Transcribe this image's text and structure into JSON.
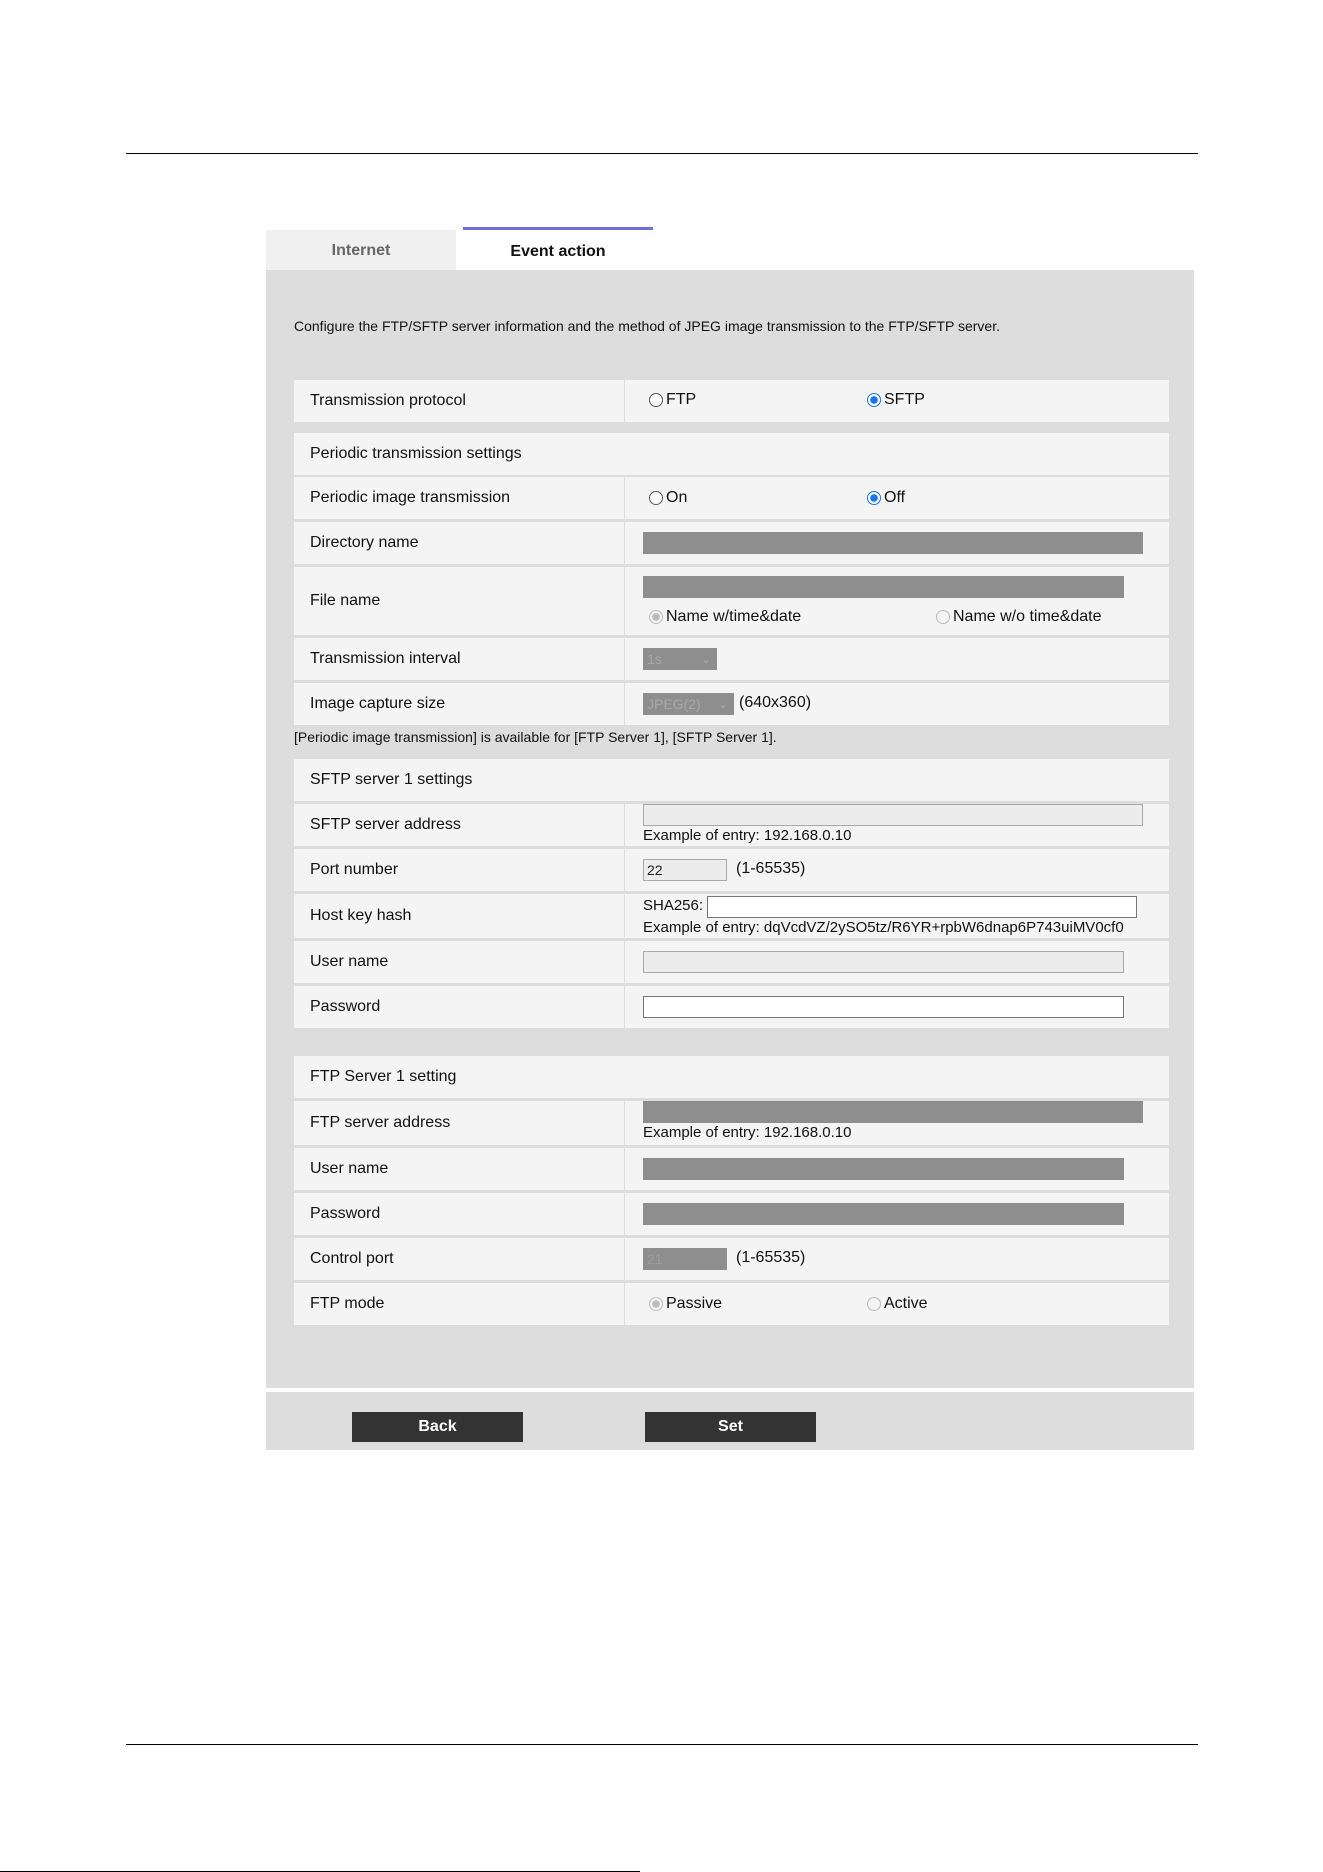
{
  "tabs": {
    "internet": "Internet",
    "event_action": "Event action"
  },
  "description": "Configure the FTP/SFTP server information and the method of JPEG image transmission to the FTP/SFTP server.",
  "protocol": {
    "label": "Transmission protocol",
    "ftp": "FTP",
    "sftp": "SFTP",
    "selected": "SFTP"
  },
  "periodic": {
    "heading": "Periodic transmission settings",
    "image_transmission": {
      "label": "Periodic image transmission",
      "on": "On",
      "off": "Off",
      "selected": "Off"
    },
    "directory": {
      "label": "Directory name",
      "value": ""
    },
    "file_name": {
      "label": "File name",
      "value": "",
      "opt1": "Name w/time&date",
      "opt2": "Name w/o time&date",
      "selected": "Name w/time&date"
    },
    "interval": {
      "label": "Transmission interval",
      "value": "1s"
    },
    "capture": {
      "label": "Image capture size",
      "value": "JPEG(2)",
      "resolution": "(640x360)"
    },
    "note": "[Periodic image transmission] is available for [FTP Server 1], [SFTP Server 1]."
  },
  "sftp": {
    "heading": "SFTP server 1 settings",
    "address": {
      "label": "SFTP server address",
      "value": "",
      "example": "Example of entry: 192.168.0.10"
    },
    "port": {
      "label": "Port number",
      "value": "22",
      "range": "(1-65535)"
    },
    "hostkey": {
      "label": "Host key hash",
      "prefix": "SHA256:",
      "value": "",
      "example": "Example of entry: dqVcdVZ/2ySO5tz/R6YR+rpbW6dnap6P743uiMV0cf0"
    },
    "user": {
      "label": "User name",
      "value": ""
    },
    "password": {
      "label": "Password",
      "value": ""
    }
  },
  "ftp": {
    "heading": "FTP Server 1 setting",
    "address": {
      "label": "FTP server address",
      "value": "",
      "example": "Example of entry: 192.168.0.10"
    },
    "user": {
      "label": "User name",
      "value": ""
    },
    "password": {
      "label": "Password",
      "value": ""
    },
    "control_port": {
      "label": "Control port",
      "value": "21",
      "range": "(1-65535)"
    },
    "mode": {
      "label": "FTP mode",
      "passive": "Passive",
      "active": "Active",
      "selected": "Passive"
    }
  },
  "buttons": {
    "back": "Back",
    "set": "Set"
  },
  "colors": {
    "panel": "#dddddd",
    "row": "#f4f4f4",
    "button": "#333333",
    "tab_accent": "#6e6ee0",
    "radio_selected": "#1a73e8"
  }
}
